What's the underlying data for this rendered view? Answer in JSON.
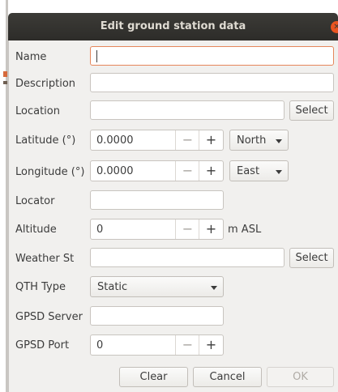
{
  "window": {
    "title": "Edit ground station data"
  },
  "form": {
    "name": {
      "label": "Name",
      "value": ""
    },
    "description": {
      "label": "Description",
      "value": ""
    },
    "location": {
      "label": "Location",
      "value": "",
      "select_label": "Select"
    },
    "latitude": {
      "label": "Latitude (°)",
      "value": "0.0000",
      "minus": "−",
      "plus": "+",
      "direction": "North"
    },
    "longitude": {
      "label": "Longitude (°)",
      "value": "0.0000",
      "minus": "−",
      "plus": "+",
      "direction": "East"
    },
    "locator": {
      "label": "Locator",
      "value": ""
    },
    "altitude": {
      "label": "Altitude",
      "value": "0",
      "minus": "−",
      "plus": "+",
      "unit": "m ASL"
    },
    "weather_station": {
      "label": "Weather St",
      "value": "",
      "select_label": "Select"
    },
    "qth_type": {
      "label": "QTH Type",
      "value": "Static"
    },
    "gpsd_server": {
      "label": "GPSD Server",
      "value": ""
    },
    "gpsd_port": {
      "label": "GPSD Port",
      "value": "0",
      "minus": "−",
      "plus": "+"
    }
  },
  "buttons": {
    "clear": "Clear",
    "cancel": "Cancel",
    "ok": "OK"
  },
  "colors": {
    "titlebar": "#3c3b37",
    "close": "#e95420",
    "focus_border": "#e5865b",
    "dialog_bg": "#f1f0ee"
  },
  "icons": {
    "close": "close-icon",
    "dropdown": "chevron-down-icon"
  }
}
